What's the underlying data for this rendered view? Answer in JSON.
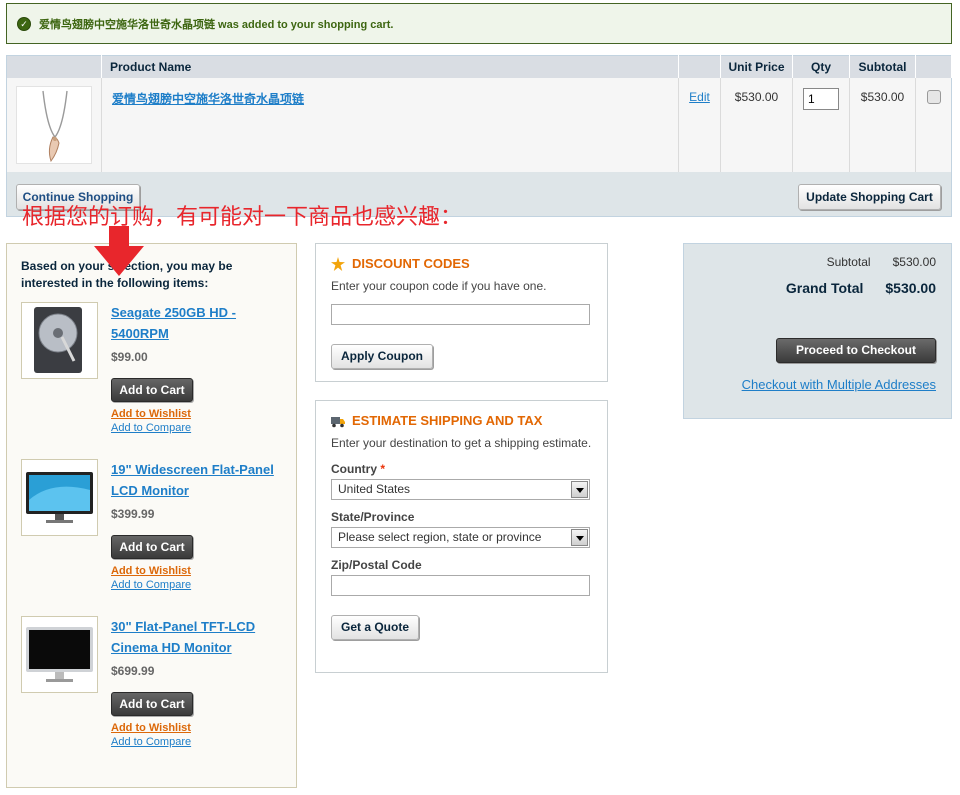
{
  "message": {
    "text": "爱情鸟翅膀中空施华洛世奇水晶项链 was added to your shopping cart."
  },
  "cart": {
    "headers": {
      "product_name": "Product Name",
      "unit_price": "Unit Price",
      "qty": "Qty",
      "subtotal": "Subtotal"
    },
    "items": [
      {
        "name": "爱情鸟翅膀中空施华洛世奇水晶项链",
        "edit_label": "Edit",
        "unit_price": "$530.00",
        "qty": "1",
        "subtotal": "$530.00",
        "image_icon": "necklace-image",
        "delete_icon": "trash-icon"
      }
    ],
    "continue_label": "Continue Shopping",
    "update_label": "Update Shopping Cart"
  },
  "annotation": {
    "text": "根据您的订购，有可能对一下商品也感兴趣："
  },
  "crosssell": {
    "title": "Based on your selection, you may be interested in the following items:",
    "items": [
      {
        "name": "Seagate 250GB HD - 5400RPM",
        "price": "$99.00",
        "add_to_cart": "Add to Cart",
        "wishlist": "Add to Wishlist",
        "compare": "Add to Compare",
        "image_icon": "hard-drive-image"
      },
      {
        "name": "19\" Widescreen Flat-Panel LCD Monitor",
        "price": "$399.99",
        "add_to_cart": "Add to Cart",
        "wishlist": "Add to Wishlist",
        "compare": "Add to Compare",
        "image_icon": "widescreen-monitor-image"
      },
      {
        "name": "30\" Flat-Panel TFT-LCD Cinema HD Monitor",
        "price": "$699.99",
        "add_to_cart": "Add to Cart",
        "wishlist": "Add to Wishlist",
        "compare": "Add to Compare",
        "image_icon": "cinema-monitor-image"
      }
    ]
  },
  "discount": {
    "title": "DISCOUNT CODES",
    "description": "Enter your coupon code if you have one.",
    "coupon_value": "",
    "apply_label": "Apply Coupon"
  },
  "shipping": {
    "title": "ESTIMATE SHIPPING AND TAX",
    "description": "Enter your destination to get a shipping estimate.",
    "country_label": "Country",
    "required_mark": "*",
    "country_value": "United States",
    "region_label": "State/Province",
    "region_value": "Please select region, state or province",
    "zip_label": "Zip/Postal Code",
    "zip_value": "",
    "quote_label": "Get a Quote"
  },
  "totals": {
    "subtotal_label": "Subtotal",
    "subtotal_value": "$530.00",
    "grand_label": "Grand Total",
    "grand_value": "$530.00",
    "checkout_label": "Proceed to Checkout",
    "multi_label": "Checkout with Multiple Addresses"
  },
  "colors": {
    "link": "#1e7ec8",
    "accent_orange": "#e26703",
    "annotation_red": "#e8262c",
    "success_green": "#3d6611"
  }
}
